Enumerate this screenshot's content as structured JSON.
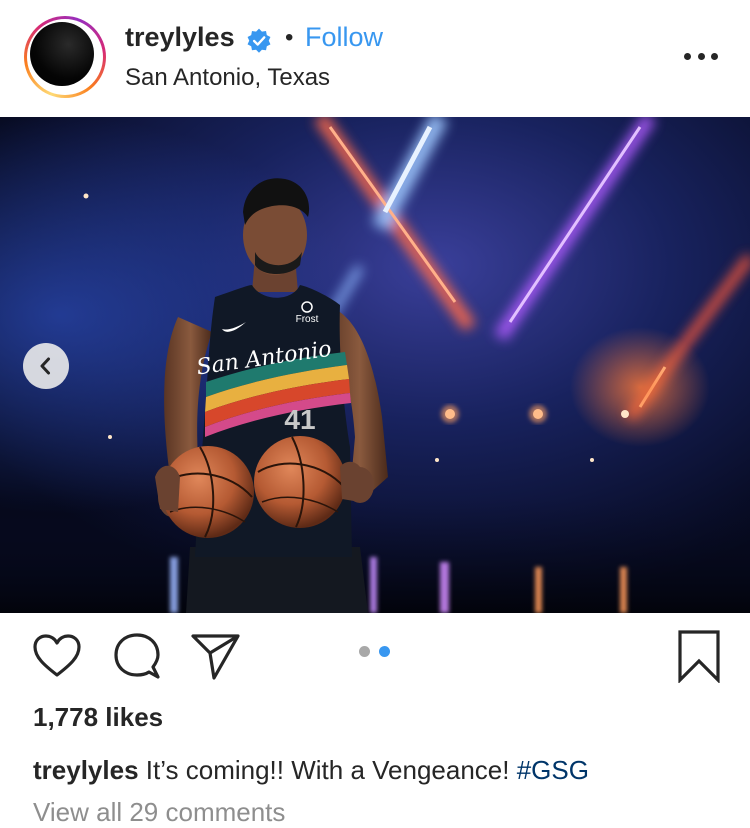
{
  "post": {
    "username": "treylyles",
    "follow_label": "Follow",
    "separator": "•",
    "location": "San Antonio, Texas",
    "likes": "1,778 likes",
    "caption_user": "treylyles",
    "caption_text": "It’s coming!! With a Vengeance! ",
    "caption_hashtag": "#GSG",
    "view_comments": "View all 29 comments"
  },
  "carousel": {
    "current": 2,
    "total": 2
  },
  "icons": {
    "verified": "verified-badge-icon",
    "more": "more-options-icon",
    "like": "heart-icon",
    "comment": "comment-bubble-icon",
    "share": "paper-plane-icon",
    "save": "bookmark-icon",
    "prev": "chevron-left-icon"
  },
  "jersey": {
    "team_script": "San Antonio",
    "number": "41",
    "sponsor": "Frost"
  },
  "colors": {
    "follow": "#3897f0",
    "hashtag": "#003569",
    "muted": "#8e8e8e",
    "dot_active": "#3897f0",
    "dot_inactive": "#a8a8a8"
  }
}
